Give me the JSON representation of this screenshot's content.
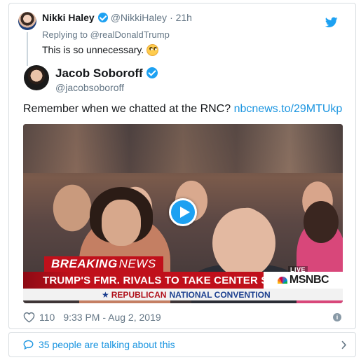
{
  "reply_tweet": {
    "name": "Nikki Haley",
    "handle": "@NikkiHaley",
    "time": "· 21h",
    "replying_to": "Replying to @realDonaldTrump",
    "text": "This is so unnecessary."
  },
  "main_tweet": {
    "name": "Jacob Soboroff",
    "handle": "@jacobsoboroff",
    "text": "Remember when we chatted at the RNC?",
    "link": "nbcnews.to/29MTUkp"
  },
  "video": {
    "breaking_bold": "BREAKING",
    "breaking_light": "NEWS",
    "headline": "TRUMP'S FMR. RIVALS TO TAKE CENTER STAGE AT RNC",
    "sub_star": "★",
    "sub_red": "REPUBLICAN",
    "sub_blue": "NATIONAL CONVENTION",
    "live": "LIVE",
    "network": "MSNBC"
  },
  "meta": {
    "likes": "110",
    "timestamp": "9:33 PM - Aug 2, 2019"
  },
  "conversation": {
    "label": "35 people are talking about this"
  },
  "colors": {
    "twitter_blue": "#1da1f2",
    "link_blue": "#1b95e0",
    "secondary_gray": "#657786",
    "breaking_red": "#c0101b"
  },
  "icons": [
    "twitter-bird-icon",
    "verified-icon",
    "heart-icon",
    "info-icon",
    "speech-bubble-icon",
    "chevron-right-icon",
    "play-icon"
  ]
}
